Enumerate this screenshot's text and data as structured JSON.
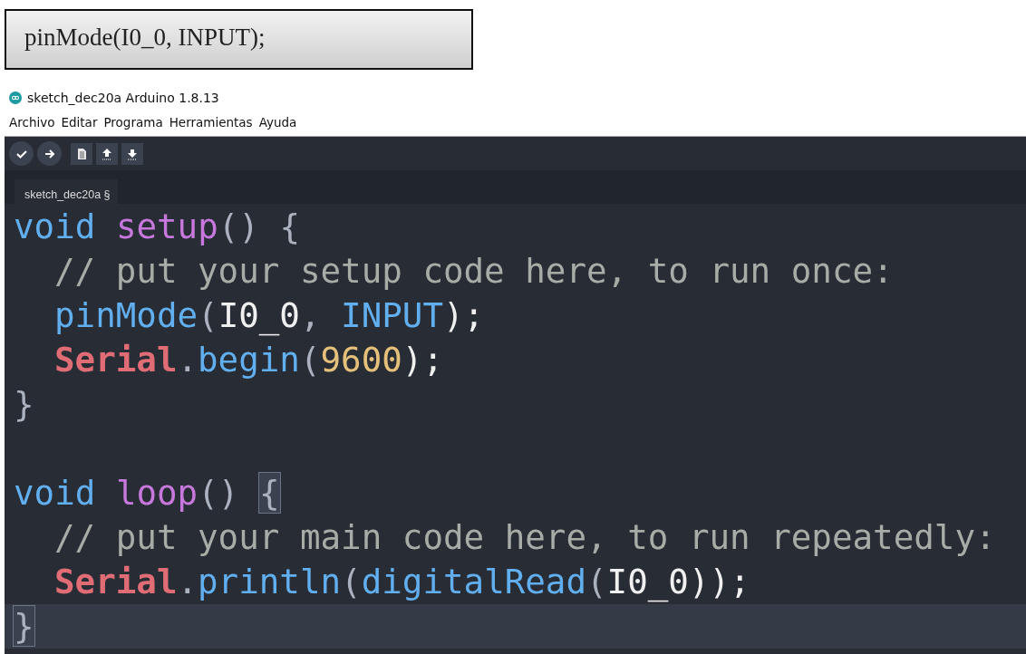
{
  "snippet": "pinMode(I0_0, INPUT);",
  "window": {
    "title": "sketch_dec20a Arduino 1.8.13"
  },
  "menu": [
    "Archivo",
    "Editar",
    "Programa",
    "Herramientas",
    "Ayuda"
  ],
  "toolbar": [
    {
      "kind": "verify"
    },
    {
      "kind": "upload"
    },
    {
      "kind": "new"
    },
    {
      "kind": "open"
    },
    {
      "kind": "save"
    }
  ],
  "tabs": [
    {
      "label": "sketch_dec20a §",
      "selected": true
    }
  ],
  "code": [
    {
      "current": false,
      "indent": false,
      "tokens": [
        {
          "text": "void ",
          "kind": "type"
        },
        {
          "text": "setup",
          "kind": "func"
        },
        {
          "text": "() {",
          "kind": "punct"
        }
      ]
    },
    {
      "current": false,
      "indent": true,
      "tokens": [
        {
          "text": "// put your setup code here, to run once:",
          "kind": "comment"
        }
      ]
    },
    {
      "current": false,
      "indent": true,
      "tokens": [
        {
          "text": "pinMode",
          "kind": "call"
        },
        {
          "text": "(",
          "kind": "punct"
        },
        {
          "text": "I0_0",
          "kind": "plain"
        },
        {
          "text": ", ",
          "kind": "punct"
        },
        {
          "text": "INPUT",
          "kind": "call"
        },
        {
          "text": ");",
          "kind": "plain"
        }
      ]
    },
    {
      "current": false,
      "indent": true,
      "tokens": [
        {
          "text": "Serial",
          "kind": "object"
        },
        {
          "text": ".",
          "kind": "punct"
        },
        {
          "text": "begin",
          "kind": "call"
        },
        {
          "text": "(",
          "kind": "punct"
        },
        {
          "text": "9600",
          "kind": "number"
        },
        {
          "text": ");",
          "kind": "plain"
        }
      ]
    },
    {
      "current": false,
      "indent": false,
      "tokens": [
        {
          "text": "}",
          "kind": "punct"
        }
      ]
    },
    {
      "current": false
    },
    {
      "current": false,
      "indent": false,
      "tokens": [
        {
          "text": "void ",
          "kind": "type"
        },
        {
          "text": "loop",
          "kind": "func"
        },
        {
          "text": "() ",
          "kind": "punct"
        },
        {
          "text": "{",
          "kind": "match"
        }
      ]
    },
    {
      "current": false,
      "indent": true,
      "tokens": [
        {
          "text": "// put your main code here, to run repeatedly:",
          "kind": "comment"
        }
      ]
    },
    {
      "current": false,
      "indent": true,
      "tokens": [
        {
          "text": "Serial",
          "kind": "object"
        },
        {
          "text": ".",
          "kind": "punct"
        },
        {
          "text": "println",
          "kind": "call"
        },
        {
          "text": "(",
          "kind": "punct"
        },
        {
          "text": "digitalRead",
          "kind": "call"
        },
        {
          "text": "(",
          "kind": "punct"
        },
        {
          "text": "I0_0",
          "kind": "plain"
        },
        {
          "text": "));",
          "kind": "plain"
        }
      ]
    },
    {
      "current": true,
      "indent": false,
      "tokens": [
        {
          "text": "}",
          "kind": "match"
        }
      ]
    }
  ]
}
